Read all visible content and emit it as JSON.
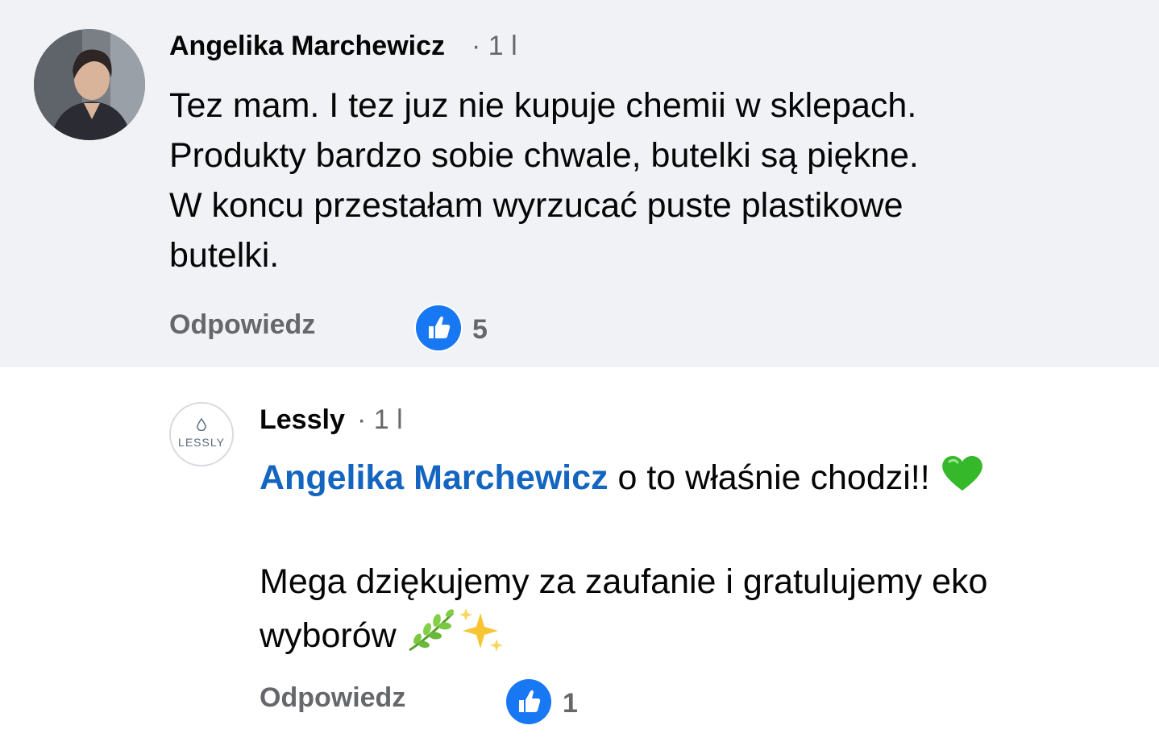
{
  "comment": {
    "author": "Angelika Marchewicz",
    "meta": "· 1 l",
    "body_lines": [
      "Tez mam. I tez juz nie kupuje chemii w sklepach.",
      "Produkty bardzo sobie chwale, butelki są piękne.",
      "W koncu przestałam wyrzucać puste plastikowe",
      "butelki."
    ],
    "reply_label": "Odpowiedz",
    "like_count": "5",
    "background_color": "#f0f2f5"
  },
  "reply": {
    "author": "Lessly",
    "meta": "· 1 l",
    "avatar_text": "LESSLY",
    "mention": "Angelika Marchewicz",
    "line1_text": " o to właśnie chodzi!! ",
    "line2_text": "Mega dziękujemy za zaufanie i gratulujemy eko",
    "line3_text": "wyborów ",
    "emojis": [
      "green-heart-icon",
      "herb-icon",
      "sparkles-icon"
    ],
    "reply_label": "Odpowiedz",
    "like_count": "1"
  },
  "colors": {
    "like_blue": "#1877f2",
    "mention_blue": "#1465c0",
    "secondary_text": "#65676b"
  }
}
